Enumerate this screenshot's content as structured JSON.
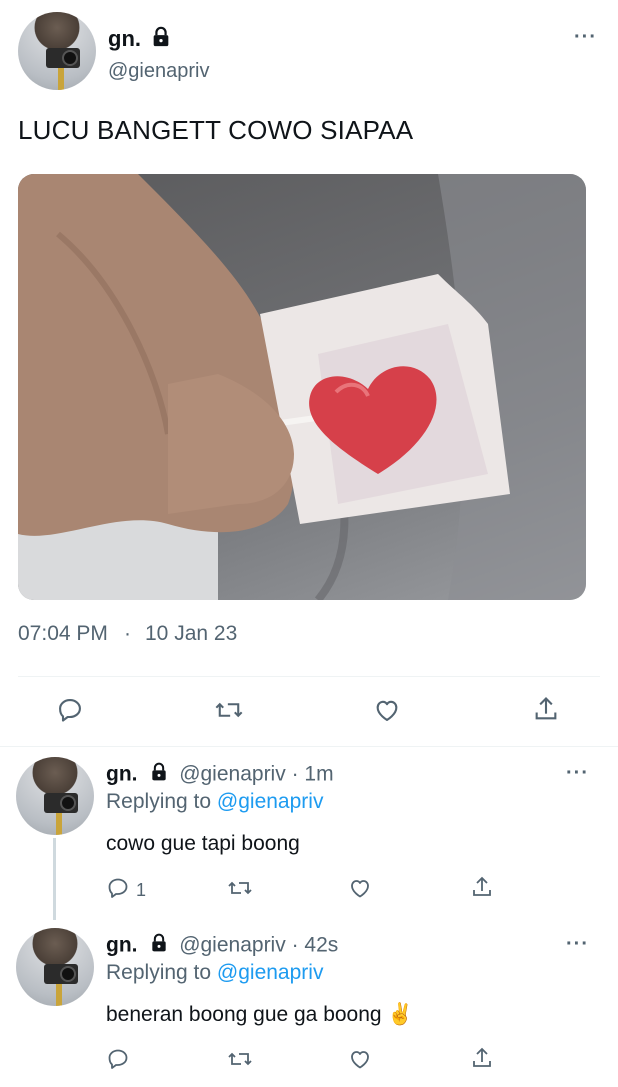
{
  "main_tweet": {
    "display_name": "gn.",
    "handle": "@gienapriv",
    "text": "LUCU BANGETT COWO SIAPAA",
    "time": "07:04 PM",
    "separator": "·",
    "date": "10 Jan 23",
    "image_description": "hand holding heart lollipop"
  },
  "replies": [
    {
      "display_name": "gn.",
      "handle": "@gienapriv",
      "age": "· 1m",
      "replying_prefix": "Replying to",
      "replying_handle": "@gienapriv",
      "text": "cowo gue tapi boong",
      "reply_count": "1"
    },
    {
      "display_name": "gn.",
      "handle": "@gienapriv",
      "age": "· 42s",
      "replying_prefix": "Replying to",
      "replying_handle": "@gienapriv",
      "text": "beneran boong gue ga boong ✌️",
      "reply_count": ""
    }
  ],
  "icons": [
    "reply-icon",
    "retweet-icon",
    "like-icon",
    "share-icon",
    "lock-icon",
    "more-icon"
  ],
  "colors": {
    "link": "#1d9bf0",
    "muted": "#536471",
    "text": "#0f1419"
  }
}
